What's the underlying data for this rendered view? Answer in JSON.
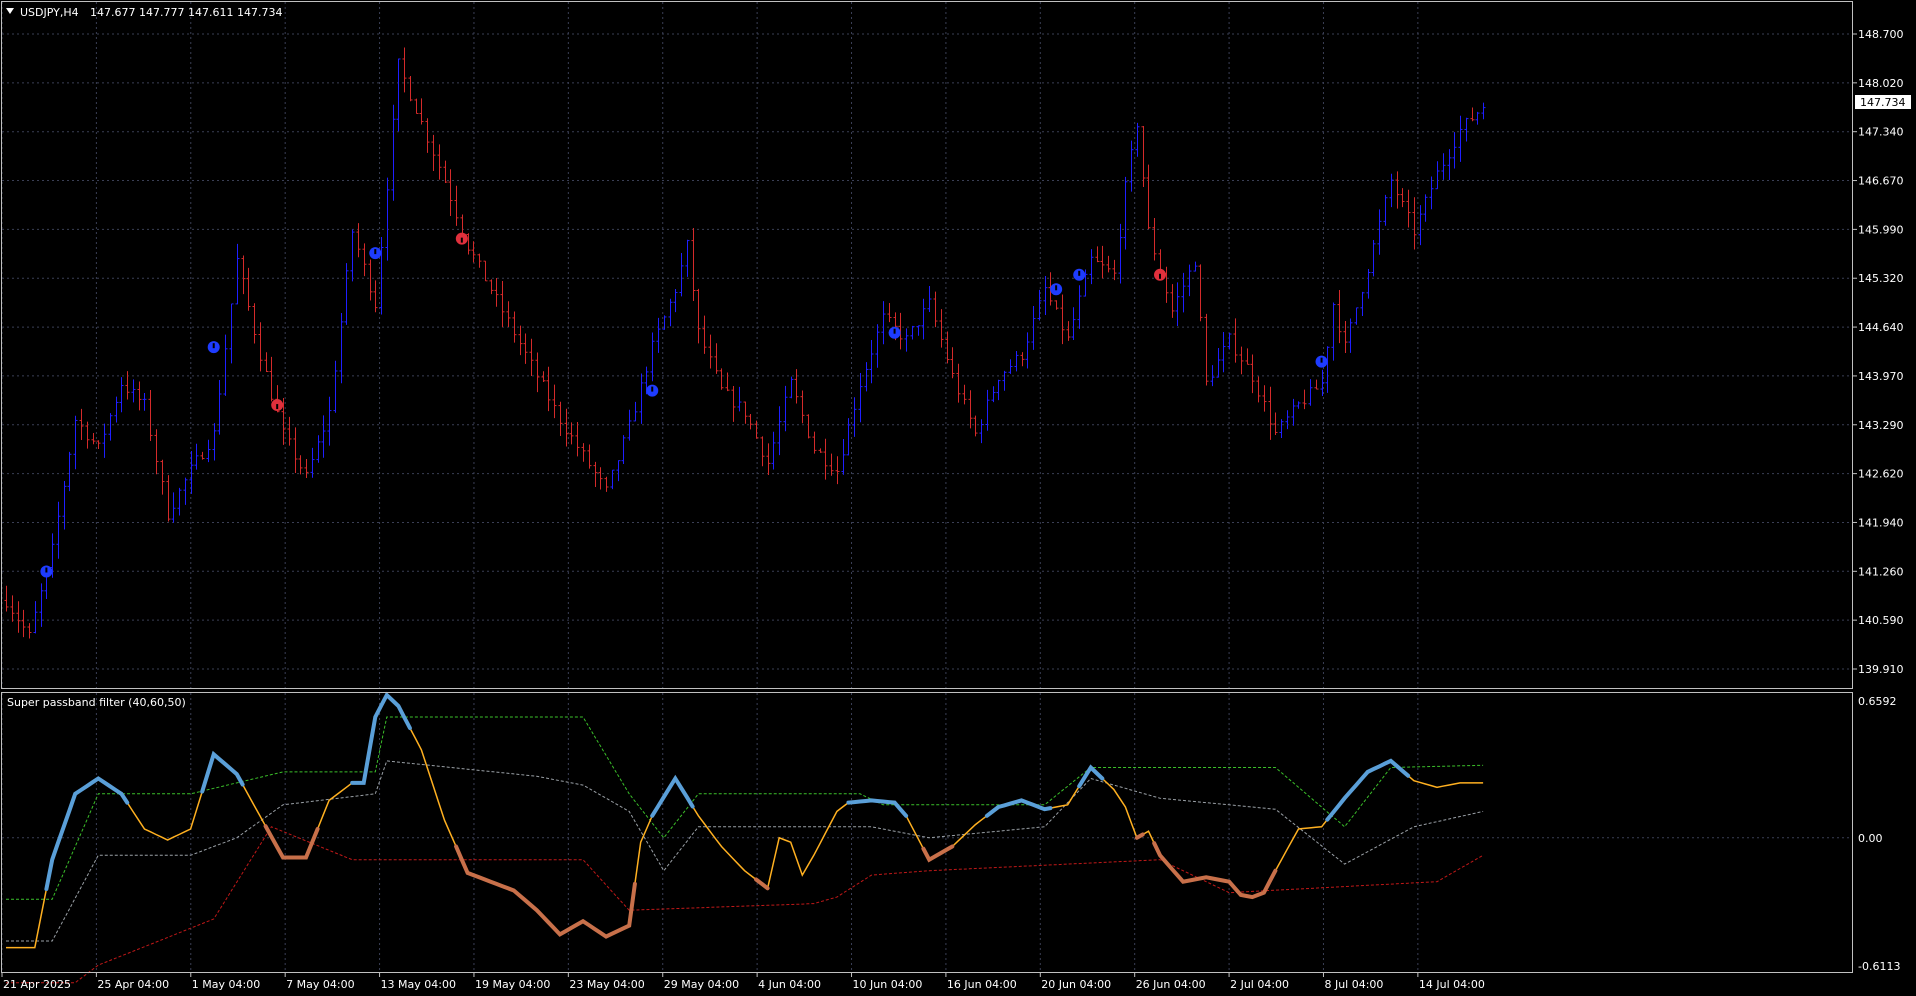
{
  "header": {
    "symbol_label": "USDJPY,H4",
    "ohlc_label": "147.677 147.777 147.611 147.734",
    "current_price": "147.734"
  },
  "indicator": {
    "label": "Super passband filter (40,60,50)",
    "axis_labels": [
      "0.6592",
      "0.00",
      "-0.6113"
    ]
  },
  "colors": {
    "background": "#000000",
    "grid": "#3a3f55",
    "bull_bar": "#1f1fff",
    "bear_bar": "#d42a2a",
    "buy_marker": "#1e3cff",
    "sell_marker": "#e0303c",
    "filter_line": "#ffb020",
    "filter_up": "#5a9fd8",
    "filter_down": "#c8704a",
    "upper_band": "#3bbf2a",
    "mid_band": "#9aa0a6",
    "lower_band": "#c01818"
  },
  "chart_data": [
    {
      "type": "candlestick",
      "symbol": "USDJPY",
      "timeframe": "H4",
      "x_tick_labels": [
        "21 Apr 2025",
        "25 Apr 04:00",
        "1 May 04:00",
        "7 May 04:00",
        "13 May 04:00",
        "19 May 04:00",
        "23 May 04:00",
        "29 May 04:00",
        "4 Jun 04:00",
        "10 Jun 04:00",
        "16 Jun 04:00",
        "20 Jun 04:00",
        "26 Jun 04:00",
        "2 Jul 04:00",
        "8 Jul 04:00",
        "14 Jul 04:00"
      ],
      "y_tick_labels": [
        "148.700",
        "148.020",
        "147.340",
        "146.670",
        "145.990",
        "145.320",
        "144.640",
        "143.970",
        "143.290",
        "142.620",
        "141.940",
        "141.260",
        "140.590",
        "139.910"
      ],
      "ylim": [
        139.69,
        149.17
      ],
      "close_path": [
        [
          0,
          140.9
        ],
        [
          4,
          140.4
        ],
        [
          8,
          141.6
        ],
        [
          12,
          143.4
        ],
        [
          16,
          143.0
        ],
        [
          20,
          143.9
        ],
        [
          24,
          143.6
        ],
        [
          28,
          142.1
        ],
        [
          32,
          142.7
        ],
        [
          36,
          143.2
        ],
        [
          40,
          145.6
        ],
        [
          44,
          144.3
        ],
        [
          48,
          143.2
        ],
        [
          52,
          142.6
        ],
        [
          56,
          143.5
        ],
        [
          60,
          146.0
        ],
        [
          64,
          145.0
        ],
        [
          68,
          148.3
        ],
        [
          72,
          147.5
        ],
        [
          76,
          146.7
        ],
        [
          80,
          145.8
        ],
        [
          84,
          145.2
        ],
        [
          88,
          144.6
        ],
        [
          92,
          144.0
        ],
        [
          96,
          143.4
        ],
        [
          100,
          142.9
        ],
        [
          104,
          142.4
        ],
        [
          108,
          143.3
        ],
        [
          112,
          144.4
        ],
        [
          116,
          145.2
        ],
        [
          118,
          145.8
        ],
        [
          120,
          144.6
        ],
        [
          124,
          143.8
        ],
        [
          128,
          143.5
        ],
        [
          132,
          142.8
        ],
        [
          136,
          143.9
        ],
        [
          140,
          143.0
        ],
        [
          144,
          142.7
        ],
        [
          148,
          143.9
        ],
        [
          152,
          144.8
        ],
        [
          156,
          144.5
        ],
        [
          160,
          145.0
        ],
        [
          164,
          144.0
        ],
        [
          168,
          143.2
        ],
        [
          172,
          144.0
        ],
        [
          176,
          144.3
        ],
        [
          180,
          145.2
        ],
        [
          184,
          144.5
        ],
        [
          188,
          145.6
        ],
        [
          192,
          145.4
        ],
        [
          194,
          146.6
        ],
        [
          196,
          147.5
        ],
        [
          198,
          146.0
        ],
        [
          202,
          144.9
        ],
        [
          206,
          145.6
        ],
        [
          208,
          143.9
        ],
        [
          212,
          144.5
        ],
        [
          216,
          144.0
        ],
        [
          220,
          143.2
        ],
        [
          224,
          143.6
        ],
        [
          228,
          143.9
        ],
        [
          230,
          145.0
        ],
        [
          232,
          144.4
        ],
        [
          236,
          145.5
        ],
        [
          240,
          146.7
        ],
        [
          244,
          146.0
        ],
        [
          248,
          146.8
        ],
        [
          252,
          147.4
        ],
        [
          256,
          147.734
        ]
      ],
      "buy_markers": [
        [
          7,
          141.3
        ],
        [
          36,
          144.4
        ],
        [
          64,
          145.7
        ],
        [
          112,
          143.8
        ],
        [
          154,
          144.6
        ],
        [
          182,
          145.2
        ],
        [
          186,
          145.4
        ],
        [
          228,
          144.2
        ]
      ],
      "sell_markers": [
        [
          47,
          143.6
        ],
        [
          79,
          145.9
        ],
        [
          200,
          145.4
        ]
      ]
    },
    {
      "type": "line",
      "title": "Super passband filter (40,60,50)",
      "ylim": [
        -0.6113,
        0.6592
      ],
      "y_tick_labels": [
        "0.6592",
        "0.00",
        "-0.6113"
      ],
      "series": [
        {
          "role": "filter",
          "points": [
            [
              0,
              -0.5
            ],
            [
              5,
              -0.5
            ],
            [
              8,
              -0.1
            ],
            [
              12,
              0.2
            ],
            [
              16,
              0.27
            ],
            [
              20,
              0.2
            ],
            [
              24,
              0.04
            ],
            [
              28,
              -0.01
            ],
            [
              32,
              0.04
            ],
            [
              36,
              0.38
            ],
            [
              40,
              0.29
            ],
            [
              44,
              0.1
            ],
            [
              48,
              -0.09
            ],
            [
              52,
              -0.09
            ],
            [
              56,
              0.17
            ],
            [
              60,
              0.25
            ],
            [
              62,
              0.25
            ],
            [
              64,
              0.55
            ],
            [
              66,
              0.65
            ],
            [
              68,
              0.6
            ],
            [
              72,
              0.4
            ],
            [
              76,
              0.08
            ],
            [
              80,
              -0.16
            ],
            [
              84,
              -0.2
            ],
            [
              88,
              -0.24
            ],
            [
              92,
              -0.33
            ],
            [
              96,
              -0.44
            ],
            [
              100,
              -0.38
            ],
            [
              104,
              -0.45
            ],
            [
              108,
              -0.4
            ],
            [
              110,
              -0.02
            ],
            [
              112,
              0.1
            ],
            [
              116,
              0.27
            ],
            [
              120,
              0.1
            ],
            [
              124,
              -0.04
            ],
            [
              128,
              -0.15
            ],
            [
              132,
              -0.23
            ],
            [
              134,
              0.0
            ],
            [
              136,
              -0.02
            ],
            [
              138,
              -0.17
            ],
            [
              140,
              -0.08
            ],
            [
              144,
              0.12
            ],
            [
              146,
              0.16
            ],
            [
              150,
              0.17
            ],
            [
              154,
              0.16
            ],
            [
              156,
              0.1
            ],
            [
              160,
              -0.1
            ],
            [
              164,
              -0.04
            ],
            [
              168,
              0.06
            ],
            [
              172,
              0.14
            ],
            [
              176,
              0.17
            ],
            [
              180,
              0.13
            ],
            [
              184,
              0.15
            ],
            [
              188,
              0.32
            ],
            [
              192,
              0.22
            ],
            [
              194,
              0.14
            ],
            [
              196,
              0.0
            ],
            [
              198,
              0.03
            ],
            [
              200,
              -0.08
            ],
            [
              204,
              -0.2
            ],
            [
              208,
              -0.18
            ],
            [
              212,
              -0.2
            ],
            [
              214,
              -0.26
            ],
            [
              216,
              -0.27
            ],
            [
              218,
              -0.25
            ],
            [
              220,
              -0.15
            ],
            [
              224,
              0.04
            ],
            [
              228,
              0.05
            ],
            [
              232,
              0.18
            ],
            [
              236,
              0.3
            ],
            [
              240,
              0.35
            ],
            [
              244,
              0.26
            ],
            [
              248,
              0.23
            ],
            [
              252,
              0.25
            ],
            [
              256,
              0.25
            ]
          ]
        },
        {
          "role": "upper-band",
          "points": [
            [
              0,
              -0.28
            ],
            [
              8,
              -0.28
            ],
            [
              16,
              0.2
            ],
            [
              32,
              0.2
            ],
            [
              48,
              0.3
            ],
            [
              64,
              0.3
            ],
            [
              66,
              0.55
            ],
            [
              100,
              0.55
            ],
            [
              108,
              0.2
            ],
            [
              114,
              0.0
            ],
            [
              120,
              0.2
            ],
            [
              148,
              0.2
            ],
            [
              152,
              0.15
            ],
            [
              180,
              0.15
            ],
            [
              188,
              0.32
            ],
            [
              220,
              0.32
            ],
            [
              232,
              0.05
            ],
            [
              240,
              0.32
            ],
            [
              256,
              0.33
            ]
          ]
        },
        {
          "role": "mid-band",
          "points": [
            [
              0,
              -0.47
            ],
            [
              8,
              -0.47
            ],
            [
              16,
              -0.08
            ],
            [
              32,
              -0.08
            ],
            [
              40,
              0.0
            ],
            [
              48,
              0.15
            ],
            [
              64,
              0.2
            ],
            [
              66,
              0.35
            ],
            [
              92,
              0.28
            ],
            [
              100,
              0.24
            ],
            [
              108,
              0.12
            ],
            [
              114,
              -0.15
            ],
            [
              120,
              0.05
            ],
            [
              150,
              0.05
            ],
            [
              160,
              0.0
            ],
            [
              180,
              0.05
            ],
            [
              188,
              0.27
            ],
            [
              200,
              0.18
            ],
            [
              220,
              0.13
            ],
            [
              232,
              -0.12
            ],
            [
              244,
              0.05
            ],
            [
              256,
              0.12
            ]
          ]
        },
        {
          "role": "lower-band",
          "points": [
            [
              0,
              -0.66
            ],
            [
              12,
              -0.66
            ],
            [
              16,
              -0.58
            ],
            [
              36,
              -0.37
            ],
            [
              46,
              0.05
            ],
            [
              60,
              -0.1
            ],
            [
              100,
              -0.1
            ],
            [
              108,
              -0.33
            ],
            [
              140,
              -0.3
            ],
            [
              144,
              -0.27
            ],
            [
              150,
              -0.17
            ],
            [
              160,
              -0.15
            ],
            [
              200,
              -0.1
            ],
            [
              212,
              -0.25
            ],
            [
              248,
              -0.2
            ],
            [
              256,
              -0.08
            ]
          ]
        }
      ]
    }
  ]
}
